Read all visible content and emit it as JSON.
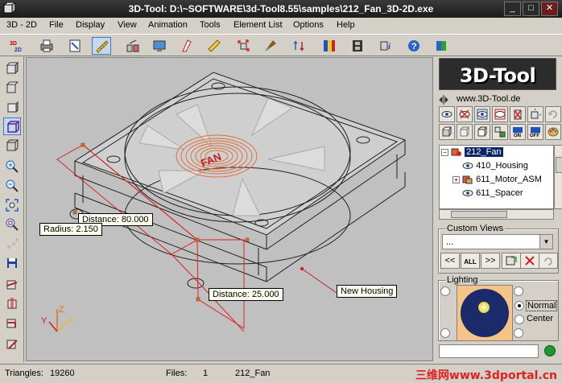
{
  "window": {
    "title": "3D-Tool: D:\\~SOFTWARE\\3d-Tool8.55\\samples\\212_Fan_3D-2D.exe",
    "minimize": "_",
    "maximize": "□",
    "close": "✕"
  },
  "menu": {
    "items": [
      "3D - 2D",
      "File",
      "Display",
      "View",
      "Animation",
      "Tools",
      "Element List",
      "Options",
      "Help"
    ]
  },
  "viewport": {
    "part_label": "FAN",
    "callouts": {
      "distance_80": "Distance: 80.000",
      "radius": "Radius: 2.150",
      "distance_25": "Distance: 25.000",
      "new_housing": "New Housing"
    },
    "axes": {
      "x": "X",
      "y": "Y",
      "z": "Z"
    }
  },
  "panel": {
    "logo": "3D-Tool",
    "url": "www.3D-Tool.de",
    "tree": [
      {
        "label": "212_Fan",
        "selected": true
      },
      {
        "label": "410_Housing"
      },
      {
        "label": "611_Motor_ASM"
      },
      {
        "label": "611_Spacer"
      }
    ],
    "custom_views": {
      "title": "Custom Views",
      "value": "...",
      "buttons": [
        "<<",
        "ALL",
        ">>"
      ]
    },
    "lighting": {
      "title": "Lighting",
      "normal": "Normal",
      "center": "Center"
    }
  },
  "statusbar": {
    "triangles_label": "Triangles:",
    "triangles_value": "19260",
    "files_label": "Files:",
    "files_value": "1",
    "file_name": "212_Fan",
    "watermark": "三维网www.3dportal.cn"
  },
  "colors": {
    "dimension_red": "#e02020",
    "highlight_blue": "#0a246a",
    "fan_orange": "#e0703a"
  }
}
